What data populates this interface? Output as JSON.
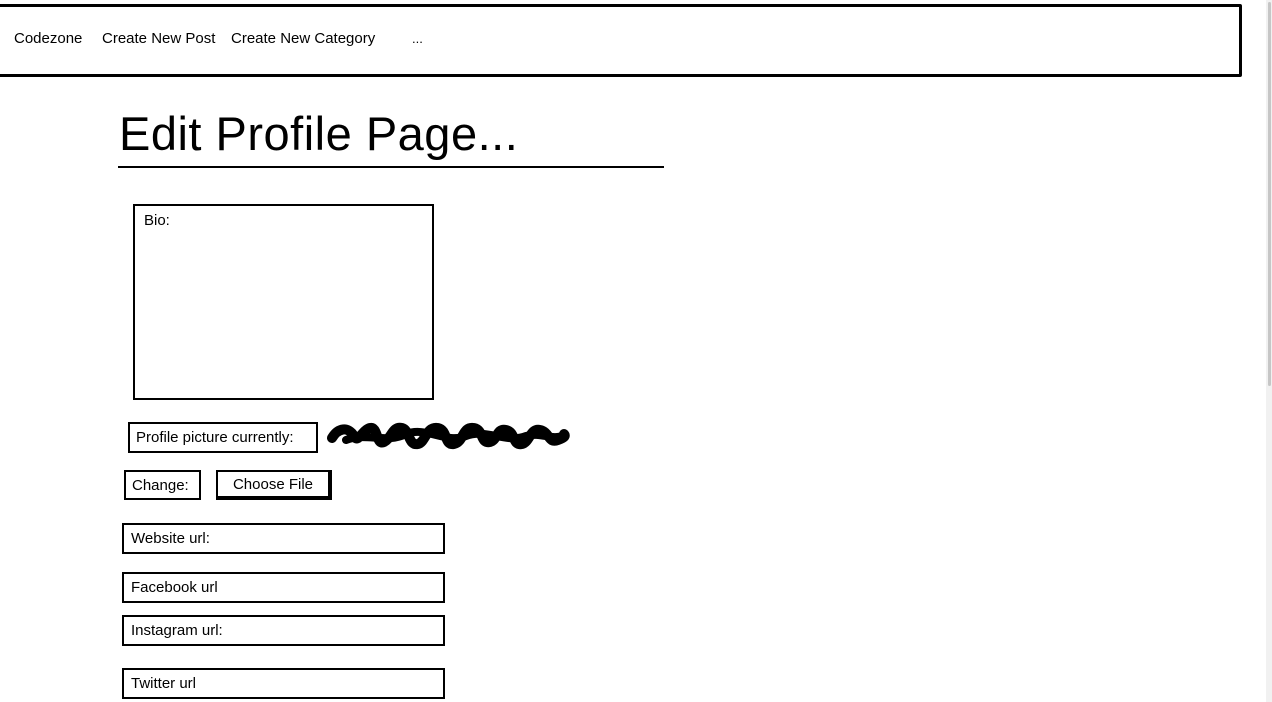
{
  "nav": {
    "brand": "Codezone",
    "links": [
      "Create New Post",
      "Create New Category"
    ],
    "more": "..."
  },
  "page": {
    "title": "Edit Profile Page..."
  },
  "form": {
    "bio_label": "Bio:",
    "profile_picture_label": "Profile picture currently:",
    "change_label": "Change:",
    "choose_file_label": "Choose File",
    "website_label": "Website url:",
    "facebook_label": "Facebook url",
    "instagram_label": "Instagram url:",
    "twitter_label": "Twitter url"
  }
}
